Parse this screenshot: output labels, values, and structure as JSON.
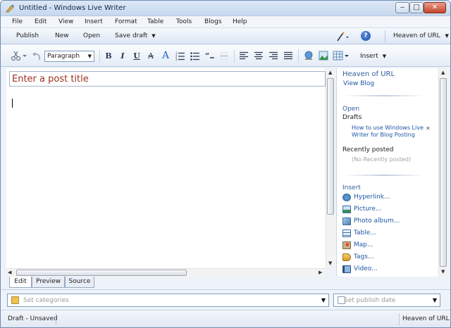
{
  "window": {
    "title": "Untitled - Windows Live Writer",
    "controls": {
      "minimize": "‒",
      "maximize": "□",
      "close": "✕"
    }
  },
  "menubar": [
    "File",
    "Edit",
    "View",
    "Insert",
    "Format",
    "Table",
    "Tools",
    "Blogs",
    "Help"
  ],
  "commandbar": {
    "publish": "Publish",
    "new": "New",
    "open": "Open",
    "save_draft": "Save draft",
    "help_icon": "?",
    "blog_account": "Heaven of URL"
  },
  "format_toolbar": {
    "paragraph_style": "Paragraph",
    "bold": "B",
    "italic": "I",
    "underline": "U",
    "strikethrough": "A",
    "font_color": "A",
    "insert_menu": "Insert"
  },
  "editor": {
    "title_placeholder": "Enter a post title"
  },
  "view_tabs": [
    "Edit",
    "Preview",
    "Source"
  ],
  "sidebar": {
    "blog_name": "Heaven of URL",
    "view_blog": "View Blog",
    "open_heading": "Open",
    "drafts_heading": "Drafts",
    "draft_item_line1": "How to use Windows Live",
    "draft_item_line2": "Writer for Blog Posting",
    "draft_remove": "✕",
    "recent_heading": "Recently posted",
    "recent_empty": "(No Recently posted)",
    "insert_heading": "Insert",
    "insert_items": [
      "Hyperlink...",
      "Picture...",
      "Photo album...",
      "Table...",
      "Map...",
      "Tags...",
      "Video..."
    ]
  },
  "properties": {
    "categories_placeholder": "Set categories",
    "publish_date_placeholder": "Set publish date"
  },
  "status": {
    "left": "Draft - Unsaved",
    "right": "Heaven of URL"
  },
  "colors": {
    "title_text": "#a0321f",
    "link": "#1f55a5",
    "heading": "#2f5d9c",
    "frame": "#6f8bb0"
  }
}
